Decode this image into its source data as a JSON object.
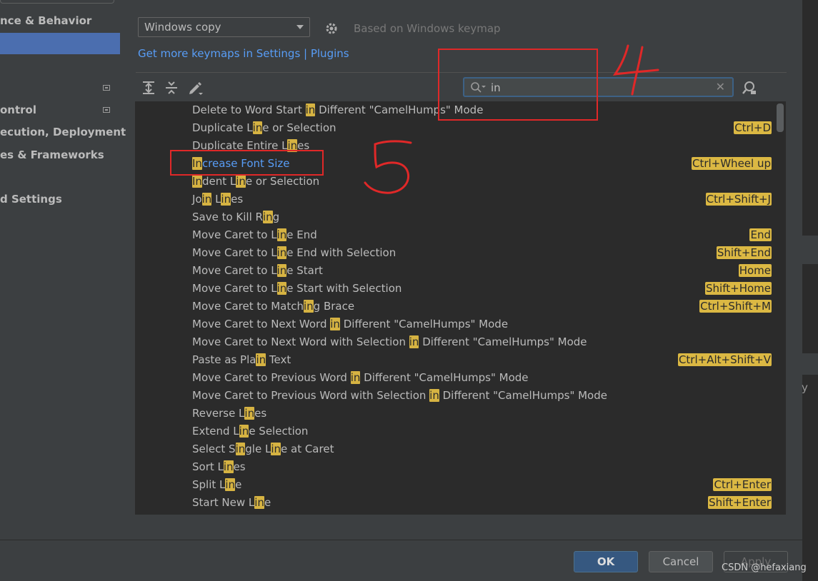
{
  "sidebar": {
    "items": [
      {
        "label": "nce & Behavior"
      },
      {
        "label": "ontrol"
      },
      {
        "label": "ecution, Deployment"
      },
      {
        "label": "es & Frameworks"
      },
      {
        "label": "d Settings"
      }
    ]
  },
  "keymap": {
    "combo_value": "Windows copy",
    "based_on": "Based on Windows keymap",
    "link_text": "Get more keymaps in Settings | Plugins"
  },
  "toolbar": {
    "expand_icon": "expand-all-icon",
    "collapse_icon": "collapse-all-icon",
    "edit_icon": "edit-pencil-icon"
  },
  "search": {
    "value": "in",
    "icon": "search-icon",
    "clear_icon": "close-icon"
  },
  "actions": [
    {
      "name": [
        "Delete to Word Start ",
        "in",
        " Different \"CamelHumps\" Mode"
      ],
      "shortcut": ""
    },
    {
      "name": [
        "Duplicate L",
        "in",
        "e or Selection"
      ],
      "shortcut": "Ctrl+D"
    },
    {
      "name": [
        "Duplicate Entire L",
        "in",
        "es"
      ],
      "shortcut": ""
    },
    {
      "name": [
        "",
        "In",
        "crease Font Size"
      ],
      "shortcut": "Ctrl+Wheel up",
      "selected": true
    },
    {
      "name": [
        "",
        "In",
        "dent L",
        "in",
        "e or Selection"
      ],
      "shortcut": ""
    },
    {
      "name": [
        "Jo",
        "in",
        " L",
        "in",
        "es"
      ],
      "shortcut": "Ctrl+Shift+J"
    },
    {
      "name": [
        "Save to Kill R",
        "in",
        "g"
      ],
      "shortcut": ""
    },
    {
      "name": [
        "Move Caret to L",
        "in",
        "e End"
      ],
      "shortcut": "End"
    },
    {
      "name": [
        "Move Caret to L",
        "in",
        "e End with Selection"
      ],
      "shortcut": "Shift+End"
    },
    {
      "name": [
        "Move Caret to L",
        "in",
        "e Start"
      ],
      "shortcut": "Home"
    },
    {
      "name": [
        "Move Caret to L",
        "in",
        "e Start with Selection"
      ],
      "shortcut": "Shift+Home"
    },
    {
      "name": [
        "Move Caret to Match",
        "in",
        "g Brace"
      ],
      "shortcut": "Ctrl+Shift+M"
    },
    {
      "name": [
        "Move Caret to Next Word ",
        "in",
        " Different \"CamelHumps\" Mode"
      ],
      "shortcut": ""
    },
    {
      "name": [
        "Move Caret to Next Word with Selection ",
        "in",
        " Different \"CamelHumps\" Mode"
      ],
      "shortcut": ""
    },
    {
      "name": [
        "Paste as Pla",
        "in",
        " Text"
      ],
      "shortcut": "Ctrl+Alt+Shift+V"
    },
    {
      "name": [
        "Move Caret to Previous Word ",
        "in",
        " Different \"CamelHumps\" Mode"
      ],
      "shortcut": ""
    },
    {
      "name": [
        "Move Caret to Previous Word with Selection ",
        "in",
        " Different \"CamelHumps\" Mode"
      ],
      "shortcut": ""
    },
    {
      "name": [
        "Reverse L",
        "in",
        "es"
      ],
      "shortcut": ""
    },
    {
      "name": [
        "Extend L",
        "in",
        "e Selection"
      ],
      "shortcut": ""
    },
    {
      "name": [
        "Select S",
        "in",
        "gle L",
        "in",
        "e at Caret"
      ],
      "shortcut": ""
    },
    {
      "name": [
        "Sort L",
        "in",
        "es"
      ],
      "shortcut": ""
    },
    {
      "name": [
        "Split L",
        "in",
        "e"
      ],
      "shortcut": "Ctrl+Enter"
    },
    {
      "name": [
        "Start New L",
        "in",
        "e"
      ],
      "shortcut": "Shift+Enter"
    }
  ],
  "buttons": {
    "ok": "OK",
    "cancel": "Cancel",
    "apply": "Apply"
  },
  "watermark": "CSDN @hefaxiang",
  "right_strip_char": "y",
  "annotations": {
    "digit_1": "4",
    "digit_2": "5"
  },
  "colors": {
    "highlight": "#d6b342",
    "link": "#589df6",
    "annotation": "#e02828",
    "selection": "#4b6eaf"
  }
}
